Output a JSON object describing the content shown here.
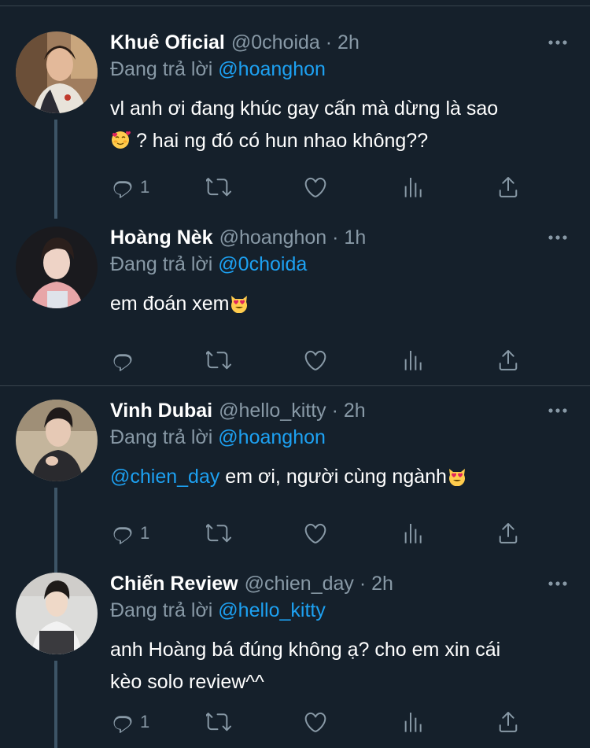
{
  "tweets": [
    {
      "name": "Khuê Oficial",
      "handle": "@0choida · 2h",
      "reply_prefix": "Đang trả lời",
      "reply_to": "@hoanghon",
      "text_line1": "vl anh ơi đang khúc gay cấn mà dừng là sao",
      "text_line2": " ? hai ng đó có hun nhao không??",
      "reply_count": "1",
      "emoji": "smiling-face-with-hearts"
    },
    {
      "name": "Hoàng Nèk",
      "handle": "@hoanghon · 1h",
      "reply_prefix": "Đang trả lời",
      "reply_to": "@0choida",
      "text": "em đoán xem",
      "reply_count": "",
      "emoji": "heart-eyes-cat"
    },
    {
      "name": "Vinh Dubai",
      "handle": "@hello_kitty · 2h",
      "reply_prefix": "Đang trả lời",
      "reply_to": "@hoanghon",
      "mention": "@chien_day",
      "text": " em ơi, người cùng ngành",
      "reply_count": "1",
      "emoji": "heart-eyes-cat"
    },
    {
      "name": "Chiến Review",
      "handle": "@chien_day · 2h",
      "reply_prefix": "Đang trả lời",
      "reply_to": "@hello_kitty",
      "text_line1": "anh Hoàng bá đúng không ạ? cho em xin cái",
      "text_line2": "kèo solo review^^",
      "reply_count": "1"
    }
  ],
  "colors": {
    "background": "#15202b",
    "secondary_text": "#8899a6",
    "link": "#1da1f2",
    "divider": "#38444d",
    "thread_line": "#3d5466"
  }
}
